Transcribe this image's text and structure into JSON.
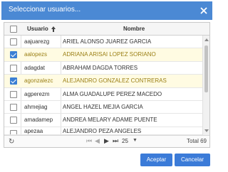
{
  "dialog": {
    "title": "Seleccionar usuarios...",
    "close_icon": "close-icon"
  },
  "grid": {
    "columns": {
      "usuario": "Usuario",
      "nombre": "Nombre",
      "sort_icon": "sort-asc-icon"
    },
    "rows": [
      {
        "usuario": "aajuarezg",
        "nombre": "ARIEL ALONSO JUAREZ GARCIA",
        "checked": false
      },
      {
        "usuario": "aalopezs",
        "nombre": "ADRIANA ARISAI LOPEZ SORIANO",
        "checked": true
      },
      {
        "usuario": "adagdat",
        "nombre": "ABRAHAM  DAGDA TORRES",
        "checked": false
      },
      {
        "usuario": "agonzalezc",
        "nombre": "ALEJANDRO  GONZALEZ CONTRERAS",
        "checked": true
      },
      {
        "usuario": "agperezm",
        "nombre": "ALMA GUADALUPE PEREZ MACEDO",
        "checked": false
      },
      {
        "usuario": "ahmejiag",
        "nombre": "ANGEL HAZEL MEJIA GARCIA",
        "checked": false
      },
      {
        "usuario": "amadamep",
        "nombre": "ANDREA MELARY ADAME PUENTE",
        "checked": false
      },
      {
        "usuario": "apezaa",
        "nombre": "ALEJANDRO  PEZA ANGELES",
        "checked": false
      }
    ]
  },
  "pager": {
    "page_size": "25",
    "total": "Total 69"
  },
  "buttons": {
    "accept": "Aceptar",
    "cancel": "Cancelar"
  },
  "colors": {
    "titlebar": "#4b89d4",
    "accent": "#3b7bd8",
    "selected_row": "#fffbe2",
    "selected_text": "#9a7f14"
  }
}
